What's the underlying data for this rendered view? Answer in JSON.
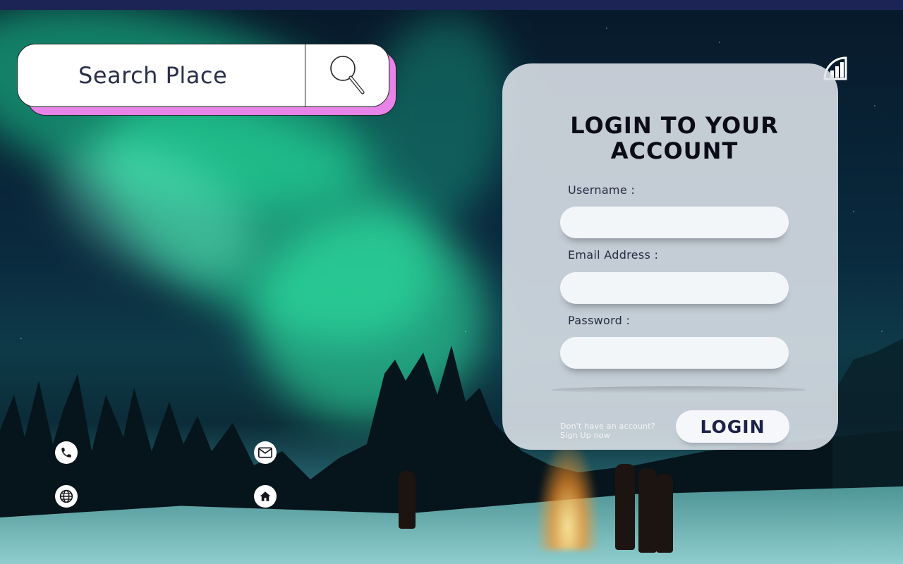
{
  "search": {
    "placeholder": "Search Place",
    "button_icon": "magnifier-icon"
  },
  "login": {
    "title_line1": "LOGIN TO YOUR",
    "title_line2": "ACCOUNT",
    "username_label": "Username   :",
    "email_label": "Email Address  :",
    "password_label": "Password   :",
    "username_value": "",
    "email_value": "",
    "password_value": "",
    "signup_line1": "Don't have an account?",
    "signup_line2": "Sign Up now",
    "login_button": "LOGIN"
  },
  "brand_icon": "bar-chart-logo-icon",
  "contact_icons": [
    "phone-icon",
    "mail-icon",
    "globe-icon",
    "home-icon"
  ],
  "colors": {
    "accent_pink": "#e883e8",
    "top_strip": "#1b2454",
    "title": "#0c0c18",
    "button_text": "#1c2148"
  }
}
